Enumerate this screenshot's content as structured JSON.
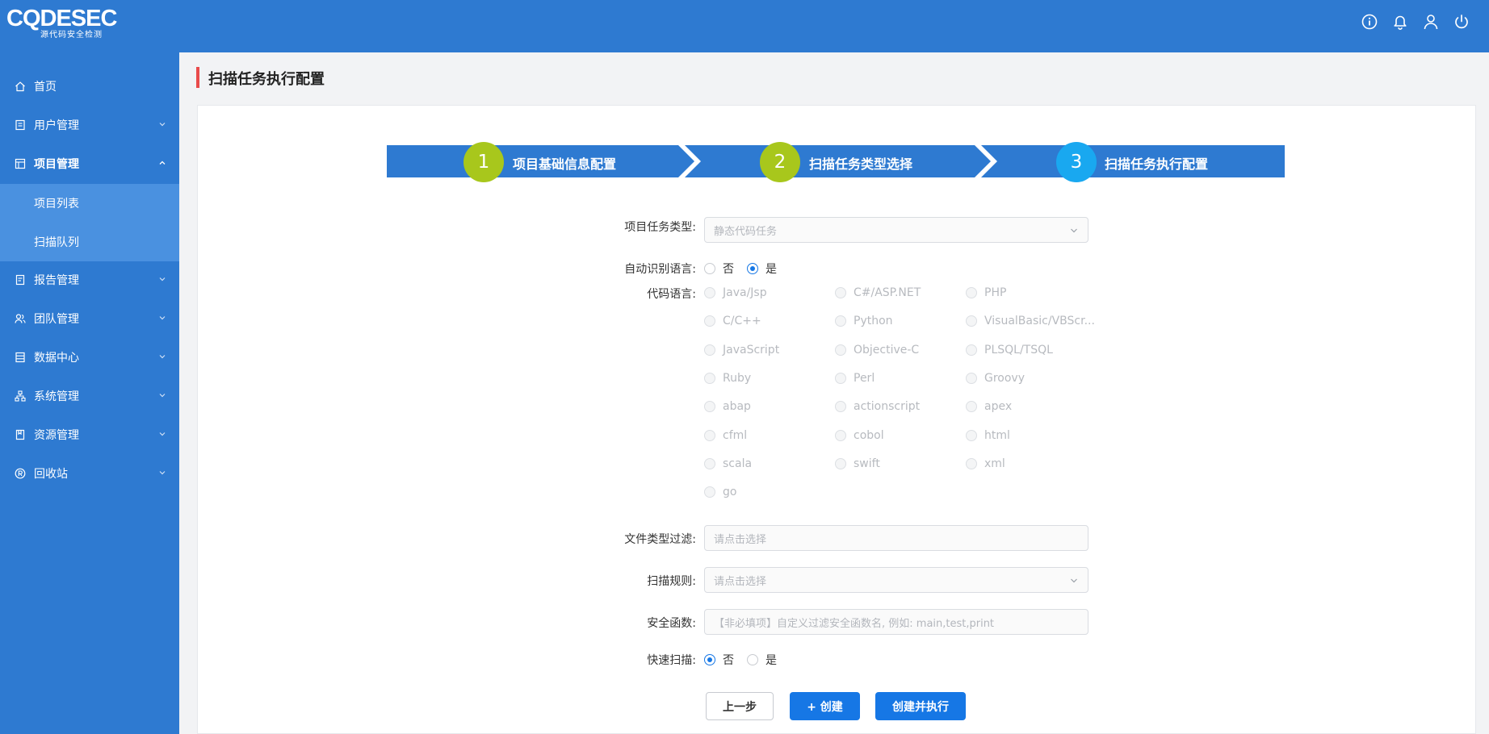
{
  "app": {
    "logo_text": "CQDESEC",
    "logo_subtitle": "源代码安全检测"
  },
  "topbar": {
    "icons": [
      "info-icon",
      "bell-icon",
      "user-icon",
      "power-icon"
    ]
  },
  "sidebar": {
    "items": [
      {
        "label": "首页",
        "icon": "home-icon"
      },
      {
        "label": "用户管理",
        "icon": "user-manage-icon"
      },
      {
        "label": "项目管理",
        "icon": "project-icon"
      },
      {
        "label": "报告管理",
        "icon": "report-icon"
      },
      {
        "label": "团队管理",
        "icon": "team-icon"
      },
      {
        "label": "数据中心",
        "icon": "data-icon"
      },
      {
        "label": "系统管理",
        "icon": "system-icon"
      },
      {
        "label": "资源管理",
        "icon": "resource-icon"
      },
      {
        "label": "回收站",
        "icon": "recycle-icon"
      }
    ],
    "subitems": [
      {
        "label": "项目列表"
      },
      {
        "label": "扫描队列"
      }
    ]
  },
  "page": {
    "title": "扫描任务执行配置"
  },
  "steps": [
    {
      "number": "1",
      "label": "项目基础信息配置",
      "color": "#a8c71c"
    },
    {
      "number": "2",
      "label": "扫描任务类型选择",
      "color": "#a8c71c"
    },
    {
      "number": "3",
      "label": "扫描任务执行配置",
      "color": "#19a8f0"
    }
  ],
  "form": {
    "task_type": {
      "label": "项目任务类型:",
      "value": "静态代码任务"
    },
    "auto_lang": {
      "label": "自动识别语言:",
      "options": [
        "否",
        "是"
      ],
      "selected": "是"
    },
    "code_lang": {
      "label": "代码语言:",
      "options": [
        "Java/Jsp",
        "C#/ASP.NET",
        "PHP",
        "C/C++",
        "Python",
        "VisualBasic/VBScr...",
        "JavaScript",
        "Objective-C",
        "PLSQL/TSQL",
        "Ruby",
        "Perl",
        "Groovy",
        "abap",
        "actionscript",
        "apex",
        "cfml",
        "cobol",
        "html",
        "scala",
        "swift",
        "xml",
        "go"
      ]
    },
    "file_filter": {
      "label": "文件类型过滤:",
      "placeholder": "请点击选择"
    },
    "scan_rules": {
      "label": "扫描规则:",
      "placeholder": "请点击选择"
    },
    "safe_funcs": {
      "label": "安全函数:",
      "placeholder": "【非必填项】自定义过滤安全函数名, 例如: main,test,print"
    },
    "quick_scan": {
      "label": "快速扫描:",
      "options": [
        "否",
        "是"
      ],
      "selected": "否"
    }
  },
  "buttons": {
    "prev": "上一步",
    "create": "+ 创建",
    "create_run": "创建并执行"
  },
  "colors": {
    "primary": "#2e7ad1",
    "accent": "#1677e5",
    "step_done": "#a8c71c",
    "step_current": "#19a8f0",
    "title_bar": "#e94b4b"
  }
}
